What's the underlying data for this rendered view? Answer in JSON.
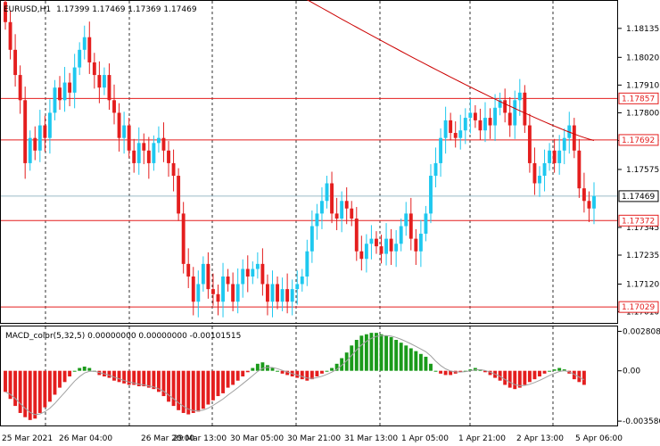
{
  "header": {
    "symbol_timeframe": "EURUSD,H1",
    "ohlc": "1.17399 1.17469 1.17369 1.17469"
  },
  "macd_header": "MACD_color(5,32,5) 0.00000000 0.00000000 -0.00101515",
  "colors": {
    "bull": "#1ec8ef",
    "bear": "#e41e1e",
    "hline": "#e41e1e",
    "ma": "#cc0000",
    "macd_pos": "#1a9a1a",
    "macd_neg": "#e41e1e",
    "signal": "#a0a0a0",
    "grid": "#000000",
    "price_box_current": "#ffffff",
    "price_box_level": "#ffffff"
  },
  "chart_data": {
    "type": "candlestick",
    "price_axis_ticks": [
      "1.18135",
      "1.18020",
      "1.17910",
      "1.17800",
      "1.17690",
      "1.17575",
      "1.17345",
      "1.17235",
      "1.17120",
      "1.17010"
    ],
    "time_axis_ticks": [
      "25 Mar 2021",
      "26 Mar 04:00",
      "26 Mar 20:00",
      "29 Mar 13:00",
      "30 Mar 05:00",
      "30 Mar 21:00",
      "31 Mar 13:00",
      "1 Apr 05:00",
      "1 Apr 21:00",
      "2 Apr 13:00",
      "5 Apr 06:00"
    ],
    "horizontal_levels": [
      {
        "label": "1.17857",
        "value": 1.17857
      },
      {
        "label": "1.17692",
        "value": 1.17692
      },
      {
        "label": "1.17372",
        "value": 1.17372
      },
      {
        "label": "1.17029",
        "value": 1.17029
      }
    ],
    "current_price": {
      "label": "1.17469",
      "value": 1.17469
    },
    "ylim": [
      1.1698,
      1.1823
    ],
    "closes": [
      1.1816,
      1.1805,
      1.1795,
      1.1785,
      1.176,
      1.177,
      1.1765,
      1.1775,
      1.177,
      1.178,
      1.179,
      1.1785,
      1.1792,
      1.1788,
      1.1798,
      1.1805,
      1.181,
      1.18,
      1.1795,
      1.179,
      1.1795,
      1.1785,
      1.178,
      1.177,
      1.1775,
      1.1765,
      1.176,
      1.1768,
      1.1765,
      1.176,
      1.1768,
      1.177,
      1.1765,
      1.176,
      1.1755,
      1.174,
      1.172,
      1.1715,
      1.1705,
      1.1712,
      1.172,
      1.171,
      1.1708,
      1.1705,
      1.1715,
      1.1712,
      1.1705,
      1.1712,
      1.1718,
      1.1715,
      1.1718,
      1.172,
      1.1712,
      1.1705,
      1.1712,
      1.1705,
      1.171,
      1.1705,
      1.171,
      1.1712,
      1.1715,
      1.1725,
      1.1735,
      1.174,
      1.1745,
      1.1752,
      1.174,
      1.1738,
      1.1745,
      1.1742,
      1.1738,
      1.1725,
      1.1722,
      1.1728,
      1.173,
      1.1727,
      1.1724,
      1.173,
      1.1725,
      1.1728,
      1.1735,
      1.174,
      1.173,
      1.1725,
      1.1732,
      1.174,
      1.1755,
      1.176,
      1.177,
      1.1777,
      1.1772,
      1.177,
      1.1773,
      1.1778,
      1.178,
      1.1777,
      1.1773,
      1.1778,
      1.1775,
      1.1782,
      1.1785,
      1.178,
      1.1775,
      1.1785,
      1.1788,
      1.1775,
      1.176,
      1.1752,
      1.1755,
      1.176,
      1.1765,
      1.176,
      1.1765,
      1.177,
      1.1775,
      1.1765,
      1.175,
      1.1745,
      1.1742,
      1.1747
    ],
    "moving_average": {
      "from_index": 60,
      "start_value": 1.1826,
      "end_value": 1.1769
    },
    "macd": {
      "ylim": [
        -0.0037,
        0.0029
      ],
      "axis_ticks": [
        "0.0028085",
        "0.00",
        "-0.003580"
      ],
      "values": [
        -0.0015,
        -0.002,
        -0.0025,
        -0.003,
        -0.0033,
        -0.0035,
        -0.0034,
        -0.003,
        -0.0026,
        -0.0022,
        -0.0017,
        -0.0012,
        -0.0008,
        -0.0004,
        0.0,
        0.0002,
        0.0003,
        0.0002,
        0.0,
        -0.0003,
        -0.0004,
        -0.0005,
        -0.0007,
        -0.0008,
        -0.0009,
        -0.001,
        -0.001,
        -0.0011,
        -0.0011,
        -0.0012,
        -0.0013,
        -0.0015,
        -0.0018,
        -0.0022,
        -0.0025,
        -0.0028,
        -0.003,
        -0.0031,
        -0.003,
        -0.0029,
        -0.0027,
        -0.0024,
        -0.0021,
        -0.0018,
        -0.0016,
        -0.0012,
        -0.001,
        -0.0007,
        -0.0004,
        -0.0001,
        0.0002,
        0.0005,
        0.0006,
        0.0004,
        0.0002,
        0.0,
        -0.0002,
        -0.0003,
        -0.0004,
        -0.0005,
        -0.0006,
        -0.0007,
        -0.0006,
        -0.0004,
        -0.0002,
        0.0,
        0.0002,
        0.0005,
        0.0009,
        0.0013,
        0.0018,
        0.0022,
        0.0025,
        0.0026,
        0.0027,
        0.0027,
        0.0026,
        0.0025,
        0.0024,
        0.0022,
        0.002,
        0.0018,
        0.0016,
        0.0014,
        0.0012,
        0.001,
        0.0005,
        0.0,
        -0.0002,
        -0.0003,
        -0.0003,
        -0.0002,
        -0.0001,
        0.0,
        0.0001,
        0.0002,
        0.0001,
        -0.0001,
        -0.0003,
        -0.0005,
        -0.0007,
        -0.001,
        -0.0012,
        -0.0013,
        -0.0012,
        -0.001,
        -0.0008,
        -0.0006,
        -0.0004,
        -0.0002,
        0.0,
        0.0001,
        0.0002,
        0.0001,
        -0.0002,
        -0.0006,
        -0.0008,
        -0.001
      ]
    }
  }
}
